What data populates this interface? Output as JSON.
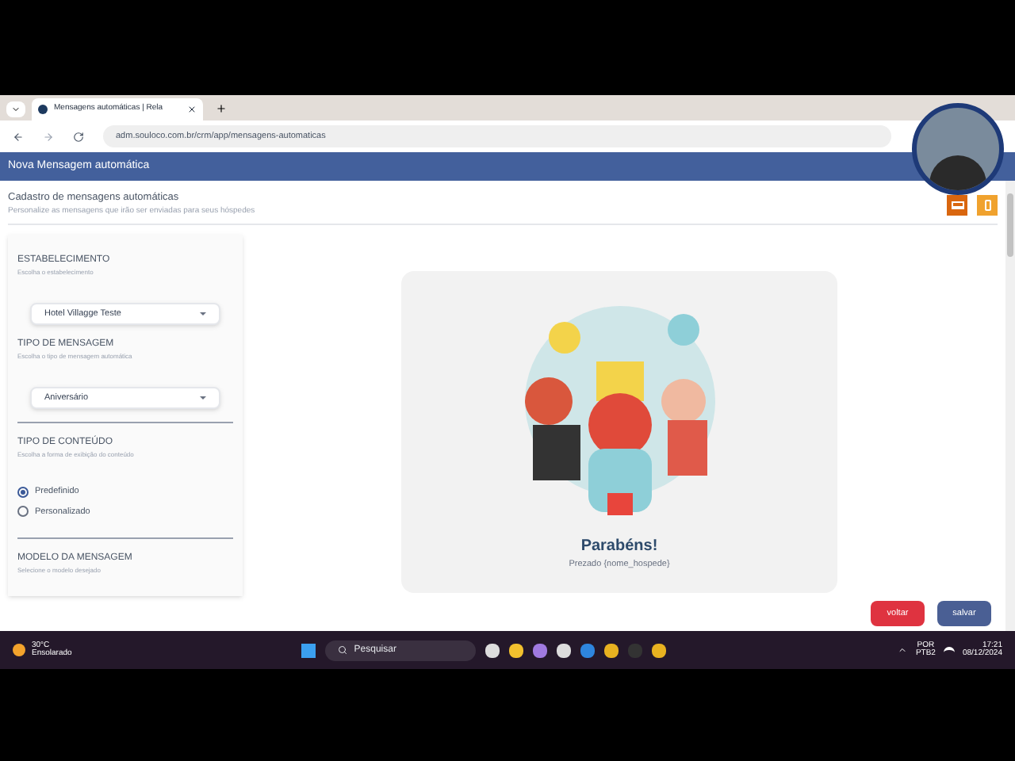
{
  "browser": {
    "tab_title": "Mensagens automáticas | Rela",
    "url": "adm.souloco.com.br/crm/app/mensagens-automaticas"
  },
  "page": {
    "title": "Nova Mensagem automática",
    "section_title": "Cadastro de mensagens automáticas",
    "section_subtitle": "Personalize as mensagens que irão ser enviadas para seus hóspedes"
  },
  "view_toggles": [
    {
      "kind": "desktop",
      "selected": true
    },
    {
      "kind": "mobile",
      "selected": false
    }
  ],
  "form": [
    {
      "kind": "select",
      "label": "ESTABELECIMENTO",
      "hint": "Escolha o estabelecimento",
      "value": "Hotel Villagge Teste"
    },
    {
      "kind": "select",
      "label": "TIPO DE MENSAGEM",
      "hint": "Escolha o tipo de mensagem automática",
      "value": "Aniversário"
    },
    {
      "kind": "radio",
      "label": "TIPO DE CONTEÚDO",
      "hint": "Escolha a forma de exibição do conteúdo",
      "options": [
        {
          "label": "Predefinido",
          "selected": true
        },
        {
          "label": "Personalizado",
          "selected": false
        }
      ]
    },
    {
      "kind": "heading",
      "label": "MODELO DA MENSAGEM",
      "hint": "Selecione o modelo desejado"
    }
  ],
  "preview": {
    "title": "Parabéns!",
    "text": "Prezado {nome_hospede}"
  },
  "buttons": [
    {
      "kind": "back",
      "label": "voltar"
    },
    {
      "kind": "save",
      "label": "salvar"
    }
  ],
  "taskbar": {
    "temperature": "30°C",
    "weather": "Ensolarado",
    "search_placeholder": "Pesquisar",
    "language": "POR",
    "layout": "PTB2",
    "time": "17:21",
    "date": "08/12/2024"
  }
}
